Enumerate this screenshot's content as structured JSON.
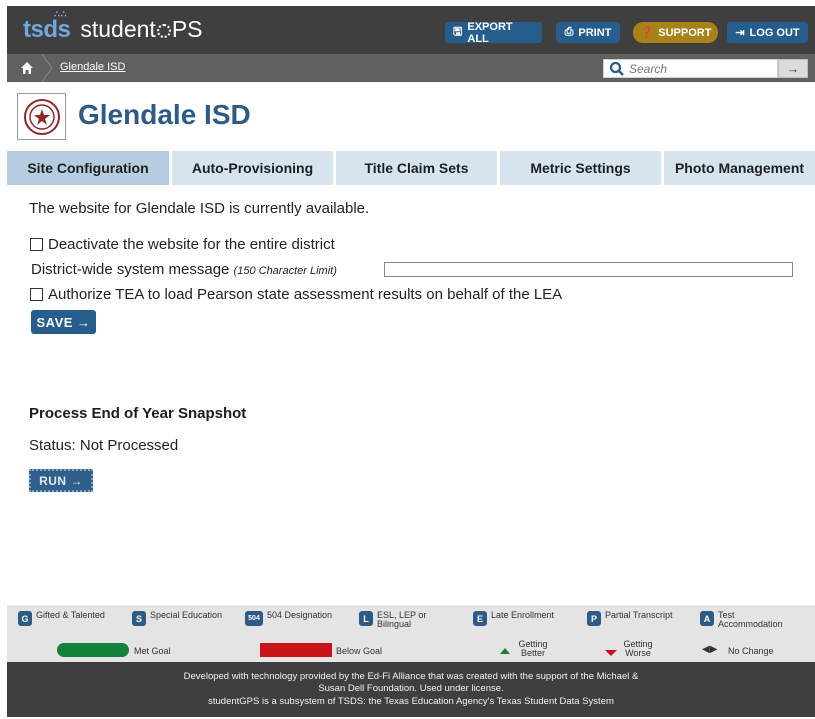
{
  "app": {
    "logo_tsds": "tsds",
    "logo_student": "student",
    "logo_gps": "PS"
  },
  "toolbar": {
    "export_label": "EXPORT ALL",
    "print_label": "PRINT",
    "support_label": "SUPPORT",
    "logout_label": "LOG OUT"
  },
  "breadcrumb": {
    "current": "Glendale ISD"
  },
  "search": {
    "placeholder": "Search",
    "go_label": "→"
  },
  "district": {
    "name": "Glendale ISD"
  },
  "tabs": [
    {
      "label": "Site Configuration",
      "active": true
    },
    {
      "label": "Auto-Provisioning",
      "active": false
    },
    {
      "label": "Title Claim Sets",
      "active": false
    },
    {
      "label": "Metric Settings",
      "active": false
    },
    {
      "label": "Photo Management",
      "active": false
    }
  ],
  "config": {
    "availability_text": "The website for Glendale ISD is currently available.",
    "deactivate_label": "Deactivate the website for the entire district",
    "deactivate_checked": false,
    "message_label": "District-wide system message ",
    "message_limit": "(150 Character Limit)",
    "message_value": "",
    "authorize_label": "Authorize TEA to load Pearson state assessment results on behalf of the LEA",
    "authorize_checked": false,
    "save_label": "SAVE →"
  },
  "eoy": {
    "title": "Process End of Year Snapshot",
    "status_text": "Status: Not Processed",
    "run_label": "RUN →"
  },
  "legend": {
    "badges": [
      {
        "code": "G",
        "label": "Gifted & Talented"
      },
      {
        "code": "S",
        "label": "Special Education"
      },
      {
        "code": "504",
        "label": "504 Designation"
      },
      {
        "code": "L",
        "label": "ESL, LEP or Bilingual"
      },
      {
        "code": "E",
        "label": "Late Enrollment"
      },
      {
        "code": "P",
        "label": "Partial Transcript"
      },
      {
        "code": "A",
        "label": "Test Accommodation"
      }
    ],
    "met_goal": "Met Goal",
    "below_goal": "Below Goal",
    "getting_better": "Getting Better",
    "getting_worse": "Getting Worse",
    "no_change": "No Change"
  },
  "footer": {
    "line1": "Developed with technology provided by the Ed-Fi Alliance that was created with the support of the Michael &",
    "line2": "Susan Dell Foundation. Used under license.",
    "line3": "studentGPS is a subsystem of TSDS: the Texas Education Agency's Texas Student Data System"
  },
  "colors": {
    "primary": "#265d8c",
    "support": "#a78218",
    "title": "#2d5b86",
    "tab_active": "#b5cde1",
    "tab": "#d6e4ef",
    "met_goal": "#13813a",
    "below_goal": "#c81419"
  },
  "icons": {
    "export": "save-icon",
    "print": "printer-icon",
    "support": "question-icon",
    "logout": "logout-icon",
    "home": "home-icon",
    "search": "search-icon"
  }
}
